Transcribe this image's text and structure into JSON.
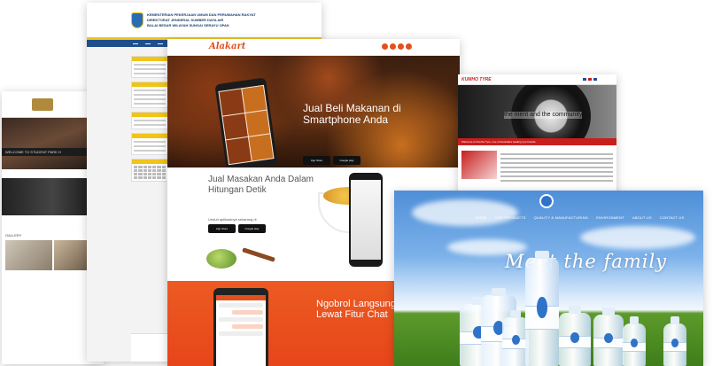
{
  "student_site": {
    "welcome": "WELCOME TO STUDENT PARK H",
    "gallery_label": "GALLERY"
  },
  "gov_site": {
    "header_lines": [
      "KEMENTERIAN PEKERJAAN UMUM DAN PERUMAHAN RAKYAT",
      "DIREKTORAT JENDERAL SUMBER DAYA AIR",
      "BALAI BESAR WILAYAH SUNGAI SERAYU OPAK"
    ]
  },
  "alakart_site": {
    "brand": "Alakart",
    "hero_title": "Jual Beli Makanan di Smartphone Anda",
    "section2_title": "Jual Masakan Anda Dalam Hitungan Detik",
    "download_label": "Unduh aplikasinya sekarang di",
    "section3_title": "Ngobrol Langsung Lewat Fitur Chat",
    "app_store": "App Store",
    "google_play": "Google play"
  },
  "kumho_site": {
    "brand": "KUMHO TYRE",
    "banner_text": "the ment and the community",
    "strip_text": "Welcome to Kumho Tyre, one of Australia's leading tyre brands."
  },
  "water_site": {
    "nav": [
      "HOME",
      "OUR PRODUCTS",
      "QUALITY & MANUFACTURING",
      "ENVIRONMENT",
      "ABOUT US",
      "CONTACT US"
    ],
    "slogan": "Meet the family"
  }
}
